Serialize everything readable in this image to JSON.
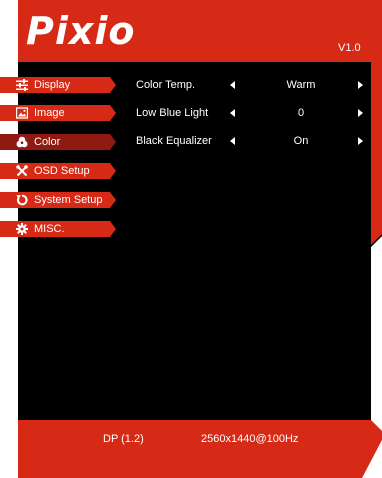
{
  "header": {
    "logo_text": "Pixio",
    "version": "V1.0"
  },
  "colors": {
    "brand_red": "#d62a17",
    "selected_item": "#8e1a12",
    "panel": "#000000",
    "text": "#ffffff"
  },
  "menu": {
    "items": [
      {
        "label": "Display",
        "icon": "sliders-icon",
        "selected": false
      },
      {
        "label": "Image",
        "icon": "picture-icon",
        "selected": false
      },
      {
        "label": "Color",
        "icon": "palette-icon",
        "selected": true
      },
      {
        "label": "OSD Setup",
        "icon": "tools-icon",
        "selected": false
      },
      {
        "label": "System Setup",
        "icon": "reset-icon",
        "selected": false
      },
      {
        "label": "MISC.",
        "icon": "gear-icon",
        "selected": false
      }
    ]
  },
  "settings": [
    {
      "name": "Color Temp.",
      "value": "Warm"
    },
    {
      "name": "Low Blue Light",
      "value": "0"
    },
    {
      "name": "Black Equalizer",
      "value": "On"
    }
  ],
  "footer": {
    "input": "DP (1.2)",
    "resolution": "2560x1440@100Hz"
  }
}
